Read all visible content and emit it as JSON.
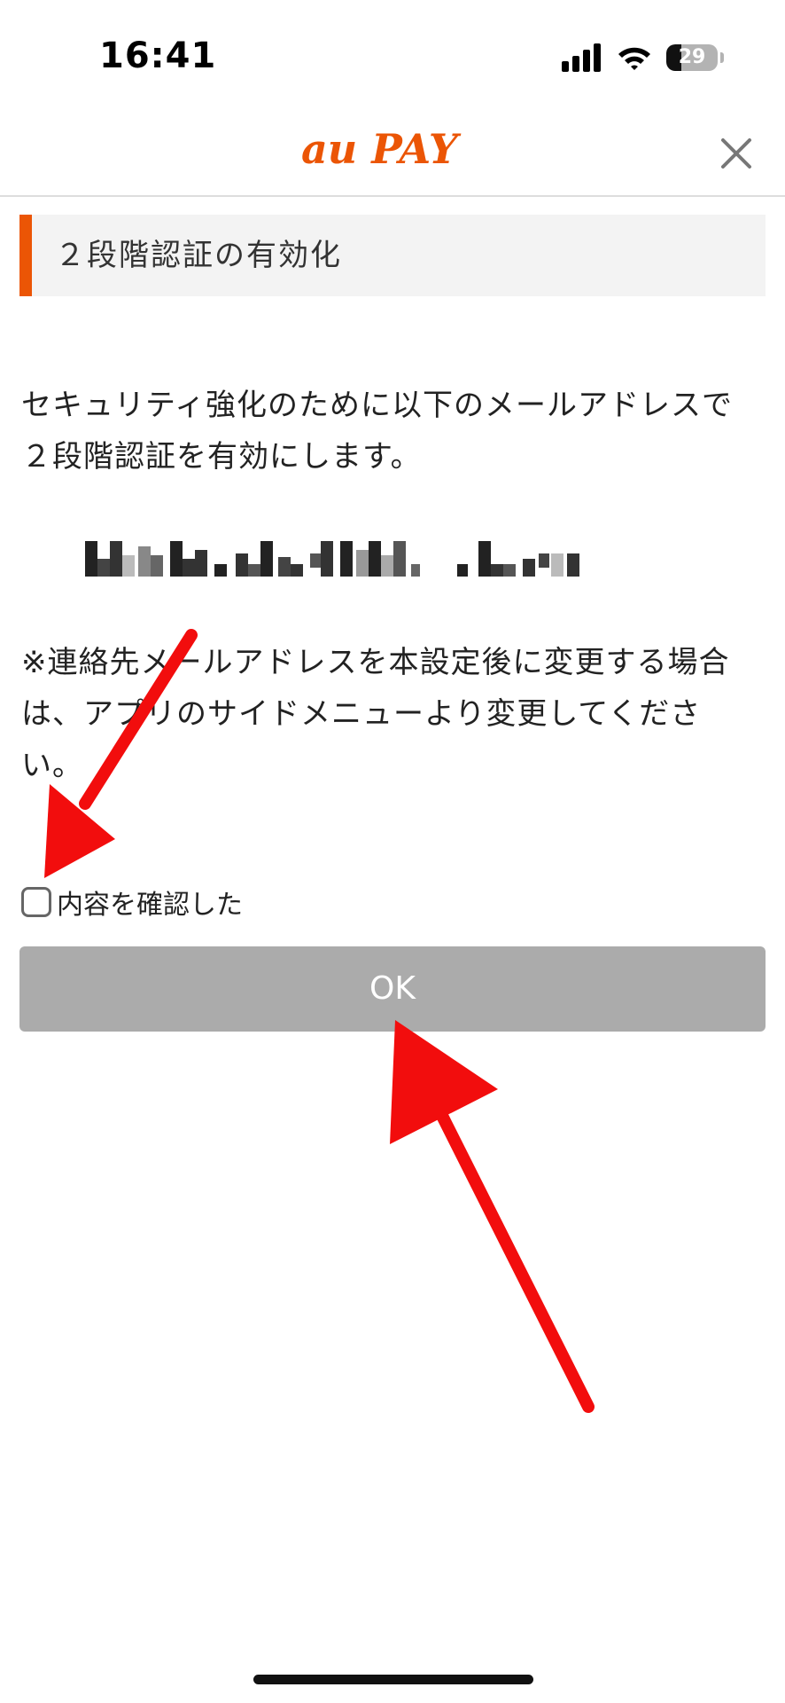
{
  "status_bar": {
    "time": "16:41",
    "battery": "29",
    "battery_fraction": 0.29,
    "icons": [
      "signal-icon",
      "wifi-icon",
      "battery-icon"
    ]
  },
  "header": {
    "logo_text": "au PAY",
    "close_icon": "close-icon"
  },
  "section": {
    "title": "２段階認証の有効化",
    "accent_color": "#eb5505"
  },
  "body": {
    "intro_line1": "セキュリティ強化のために以下のメールアドレスで",
    "intro_line2": "２段階認証を有効にします。",
    "email_masked": "pixelated-email",
    "note_line1": "※連絡先メールアドレスを本設定後に変更する場合",
    "note_line2": "は、アプリのサイドメニューより変更してくださ",
    "note_line3": "い。"
  },
  "confirm": {
    "label": "内容を確認した",
    "checked": false
  },
  "ok_button": {
    "label": "OK",
    "color": "#ababab"
  },
  "annotations": {
    "arrow_color": "#f20d0d",
    "arrows": [
      "arrow-to-checkbox",
      "arrow-to-ok-button"
    ]
  }
}
